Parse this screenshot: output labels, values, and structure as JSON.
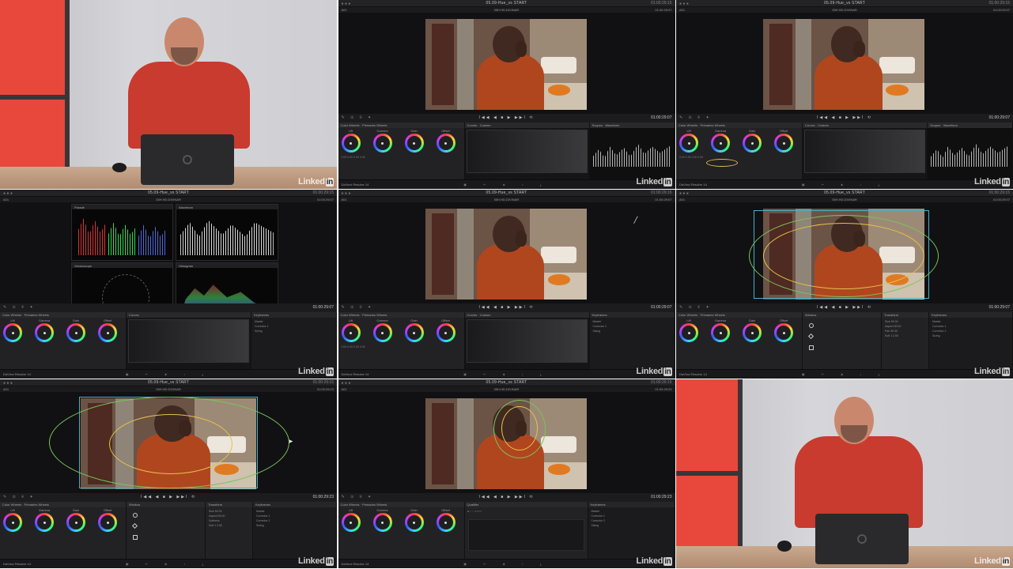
{
  "watermark": {
    "brand": "Linked",
    "brand_in": "in"
  },
  "resolve": {
    "project_title": "05.09-Hue_vs START",
    "clip_name": "05H.HD.DIVINAR",
    "clip_label": "A01",
    "timecode_viewer": "01:00:29:07",
    "timecode_viewer_alt": "01:00:29:23",
    "timecode_top": "01:00:29:15",
    "app_name": "DaVinci Resolve 14",
    "transport_controls": "I◀◀ ◀ ■ ▶ ▶▶I ⟲",
    "tool_icons": "✎ ⊙ ⌾ ✦",
    "pages": "▣ ✂ ◈ ♪ ⤓",
    "panel_color_wheels": "Color Wheels",
    "panel_primaries": "Primaries Wheels",
    "panel_curves": "Curves",
    "panel_curves_mode": "Custom",
    "panel_scope": "Scopes",
    "panel_scope_mode": "Waveform",
    "panel_keyframes": "Keyframes",
    "panel_window": "Window",
    "panel_transform": "Transform",
    "panel_softness": "Softness",
    "panel_qualifier": "Qualifier",
    "scope_parade": "Parade",
    "scope_waveform": "Waveform",
    "scope_vectorscope": "Vectorscope",
    "scope_histogram": "Histogram",
    "scopes_title": "Scopes",
    "wheels": [
      "Lift",
      "Gamma",
      "Gain",
      "Offset"
    ],
    "wheel_values": "0.00  0.00  0.00  0.00",
    "keyframe_rows": [
      "Master",
      "Corrector 1",
      "Corrector 2",
      "Sizing"
    ],
    "transform_rows": [
      "Size  50.00",
      "Aspect  50.00",
      "Pan  50.00",
      "Tilt  50.00"
    ],
    "softness_rows": [
      "Soft 1  2.50"
    ]
  }
}
